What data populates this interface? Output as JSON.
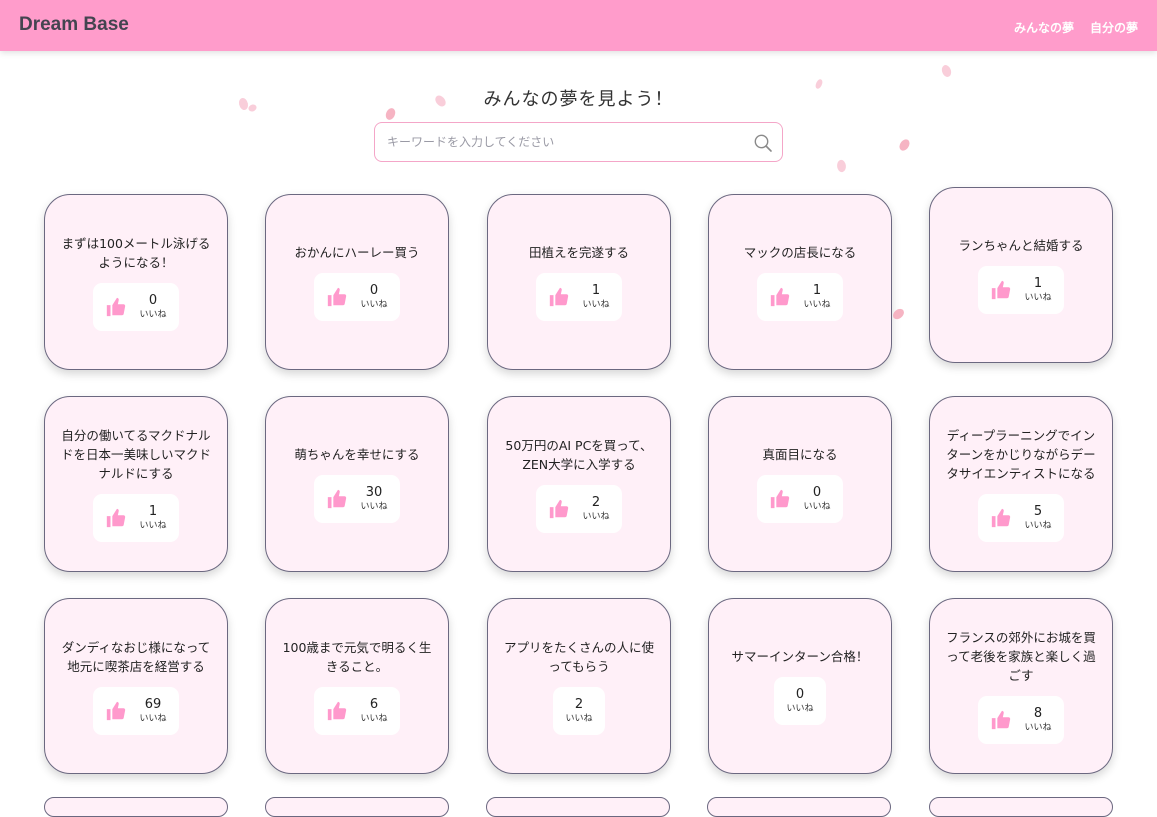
{
  "navbar": {
    "brand": "Dream Base",
    "links": [
      "みんなの夢",
      "自分の夢"
    ]
  },
  "page": {
    "heading": "みんなの夢を見よう！"
  },
  "search": {
    "placeholder": "キーワードを入力してください",
    "value": ""
  },
  "like_label": "いいね",
  "cards": [
    {
      "title": "まずは100メートル泳げるようになる！",
      "likes": "0",
      "icon": true
    },
    {
      "title": "おかんにハーレー買う",
      "likes": "0",
      "icon": true
    },
    {
      "title": "田植えを完遂する",
      "likes": "1",
      "icon": true
    },
    {
      "title": "マックの店長になる",
      "likes": "1",
      "icon": true
    },
    {
      "title": "ランちゃんと結婚する",
      "likes": "1",
      "icon": true
    },
    {
      "title": "自分の働いてるマクドナルドを日本一美味しいマクドナルドにする",
      "likes": "1",
      "icon": true
    },
    {
      "title": "萌ちゃんを幸せにする",
      "likes": "30",
      "icon": true
    },
    {
      "title": "50万円のAI PCを買って、ZEN大学に入学する",
      "likes": "2",
      "icon": true
    },
    {
      "title": "真面目になる",
      "likes": "0",
      "icon": true
    },
    {
      "title": "ディープラーニングでインターンをかじりながらデータサイエンティストになる",
      "likes": "5",
      "icon": true
    },
    {
      "title": "ダンディなおじ様になって地元に喫茶店を経営する",
      "likes": "69",
      "icon": true
    },
    {
      "title": "100歳まで元気で明るく生きること。",
      "likes": "6",
      "icon": true
    },
    {
      "title": "アプリをたくさんの人に使ってもらう",
      "likes": "2",
      "icon": false
    },
    {
      "title": "サマーインターン合格！",
      "likes": "0",
      "icon": false
    },
    {
      "title": "フランスの郊外にお城を買って老後を家族と楽しく過ごす",
      "likes": "8",
      "icon": true
    }
  ],
  "colors": {
    "navbar": "#ff9ccb",
    "card_bg": "#fff0f8",
    "thumb": "#ff99cc"
  }
}
